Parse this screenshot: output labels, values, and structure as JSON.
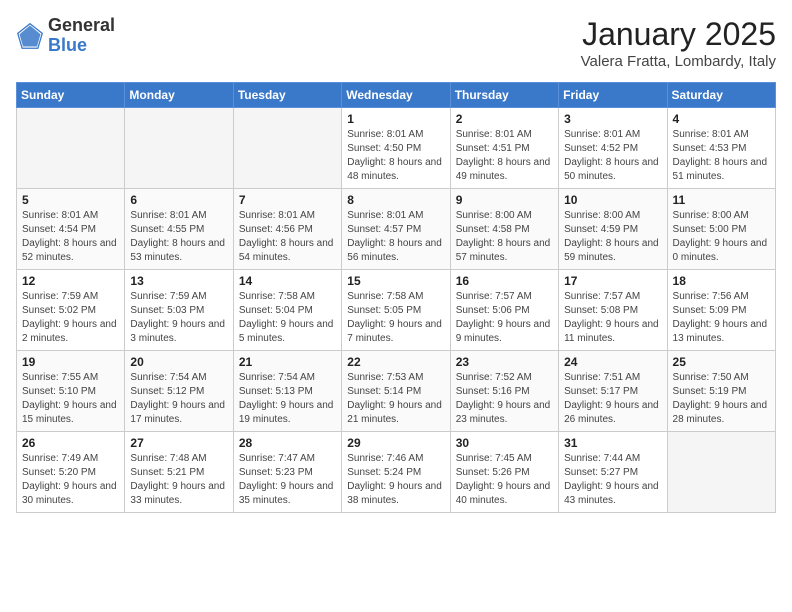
{
  "header": {
    "logo_general": "General",
    "logo_blue": "Blue",
    "month_title": "January 2025",
    "location": "Valera Fratta, Lombardy, Italy"
  },
  "weekdays": [
    "Sunday",
    "Monday",
    "Tuesday",
    "Wednesday",
    "Thursday",
    "Friday",
    "Saturday"
  ],
  "weeks": [
    [
      {
        "day": "",
        "sunrise": "",
        "sunset": "",
        "daylight": "",
        "empty": true
      },
      {
        "day": "",
        "sunrise": "",
        "sunset": "",
        "daylight": "",
        "empty": true
      },
      {
        "day": "",
        "sunrise": "",
        "sunset": "",
        "daylight": "",
        "empty": true
      },
      {
        "day": "1",
        "sunrise": "Sunrise: 8:01 AM",
        "sunset": "Sunset: 4:50 PM",
        "daylight": "Daylight: 8 hours and 48 minutes.",
        "empty": false
      },
      {
        "day": "2",
        "sunrise": "Sunrise: 8:01 AM",
        "sunset": "Sunset: 4:51 PM",
        "daylight": "Daylight: 8 hours and 49 minutes.",
        "empty": false
      },
      {
        "day": "3",
        "sunrise": "Sunrise: 8:01 AM",
        "sunset": "Sunset: 4:52 PM",
        "daylight": "Daylight: 8 hours and 50 minutes.",
        "empty": false
      },
      {
        "day": "4",
        "sunrise": "Sunrise: 8:01 AM",
        "sunset": "Sunset: 4:53 PM",
        "daylight": "Daylight: 8 hours and 51 minutes.",
        "empty": false
      }
    ],
    [
      {
        "day": "5",
        "sunrise": "Sunrise: 8:01 AM",
        "sunset": "Sunset: 4:54 PM",
        "daylight": "Daylight: 8 hours and 52 minutes.",
        "empty": false
      },
      {
        "day": "6",
        "sunrise": "Sunrise: 8:01 AM",
        "sunset": "Sunset: 4:55 PM",
        "daylight": "Daylight: 8 hours and 53 minutes.",
        "empty": false
      },
      {
        "day": "7",
        "sunrise": "Sunrise: 8:01 AM",
        "sunset": "Sunset: 4:56 PM",
        "daylight": "Daylight: 8 hours and 54 minutes.",
        "empty": false
      },
      {
        "day": "8",
        "sunrise": "Sunrise: 8:01 AM",
        "sunset": "Sunset: 4:57 PM",
        "daylight": "Daylight: 8 hours and 56 minutes.",
        "empty": false
      },
      {
        "day": "9",
        "sunrise": "Sunrise: 8:00 AM",
        "sunset": "Sunset: 4:58 PM",
        "daylight": "Daylight: 8 hours and 57 minutes.",
        "empty": false
      },
      {
        "day": "10",
        "sunrise": "Sunrise: 8:00 AM",
        "sunset": "Sunset: 4:59 PM",
        "daylight": "Daylight: 8 hours and 59 minutes.",
        "empty": false
      },
      {
        "day": "11",
        "sunrise": "Sunrise: 8:00 AM",
        "sunset": "Sunset: 5:00 PM",
        "daylight": "Daylight: 9 hours and 0 minutes.",
        "empty": false
      }
    ],
    [
      {
        "day": "12",
        "sunrise": "Sunrise: 7:59 AM",
        "sunset": "Sunset: 5:02 PM",
        "daylight": "Daylight: 9 hours and 2 minutes.",
        "empty": false
      },
      {
        "day": "13",
        "sunrise": "Sunrise: 7:59 AM",
        "sunset": "Sunset: 5:03 PM",
        "daylight": "Daylight: 9 hours and 3 minutes.",
        "empty": false
      },
      {
        "day": "14",
        "sunrise": "Sunrise: 7:58 AM",
        "sunset": "Sunset: 5:04 PM",
        "daylight": "Daylight: 9 hours and 5 minutes.",
        "empty": false
      },
      {
        "day": "15",
        "sunrise": "Sunrise: 7:58 AM",
        "sunset": "Sunset: 5:05 PM",
        "daylight": "Daylight: 9 hours and 7 minutes.",
        "empty": false
      },
      {
        "day": "16",
        "sunrise": "Sunrise: 7:57 AM",
        "sunset": "Sunset: 5:06 PM",
        "daylight": "Daylight: 9 hours and 9 minutes.",
        "empty": false
      },
      {
        "day": "17",
        "sunrise": "Sunrise: 7:57 AM",
        "sunset": "Sunset: 5:08 PM",
        "daylight": "Daylight: 9 hours and 11 minutes.",
        "empty": false
      },
      {
        "day": "18",
        "sunrise": "Sunrise: 7:56 AM",
        "sunset": "Sunset: 5:09 PM",
        "daylight": "Daylight: 9 hours and 13 minutes.",
        "empty": false
      }
    ],
    [
      {
        "day": "19",
        "sunrise": "Sunrise: 7:55 AM",
        "sunset": "Sunset: 5:10 PM",
        "daylight": "Daylight: 9 hours and 15 minutes.",
        "empty": false
      },
      {
        "day": "20",
        "sunrise": "Sunrise: 7:54 AM",
        "sunset": "Sunset: 5:12 PM",
        "daylight": "Daylight: 9 hours and 17 minutes.",
        "empty": false
      },
      {
        "day": "21",
        "sunrise": "Sunrise: 7:54 AM",
        "sunset": "Sunset: 5:13 PM",
        "daylight": "Daylight: 9 hours and 19 minutes.",
        "empty": false
      },
      {
        "day": "22",
        "sunrise": "Sunrise: 7:53 AM",
        "sunset": "Sunset: 5:14 PM",
        "daylight": "Daylight: 9 hours and 21 minutes.",
        "empty": false
      },
      {
        "day": "23",
        "sunrise": "Sunrise: 7:52 AM",
        "sunset": "Sunset: 5:16 PM",
        "daylight": "Daylight: 9 hours and 23 minutes.",
        "empty": false
      },
      {
        "day": "24",
        "sunrise": "Sunrise: 7:51 AM",
        "sunset": "Sunset: 5:17 PM",
        "daylight": "Daylight: 9 hours and 26 minutes.",
        "empty": false
      },
      {
        "day": "25",
        "sunrise": "Sunrise: 7:50 AM",
        "sunset": "Sunset: 5:19 PM",
        "daylight": "Daylight: 9 hours and 28 minutes.",
        "empty": false
      }
    ],
    [
      {
        "day": "26",
        "sunrise": "Sunrise: 7:49 AM",
        "sunset": "Sunset: 5:20 PM",
        "daylight": "Daylight: 9 hours and 30 minutes.",
        "empty": false
      },
      {
        "day": "27",
        "sunrise": "Sunrise: 7:48 AM",
        "sunset": "Sunset: 5:21 PM",
        "daylight": "Daylight: 9 hours and 33 minutes.",
        "empty": false
      },
      {
        "day": "28",
        "sunrise": "Sunrise: 7:47 AM",
        "sunset": "Sunset: 5:23 PM",
        "daylight": "Daylight: 9 hours and 35 minutes.",
        "empty": false
      },
      {
        "day": "29",
        "sunrise": "Sunrise: 7:46 AM",
        "sunset": "Sunset: 5:24 PM",
        "daylight": "Daylight: 9 hours and 38 minutes.",
        "empty": false
      },
      {
        "day": "30",
        "sunrise": "Sunrise: 7:45 AM",
        "sunset": "Sunset: 5:26 PM",
        "daylight": "Daylight: 9 hours and 40 minutes.",
        "empty": false
      },
      {
        "day": "31",
        "sunrise": "Sunrise: 7:44 AM",
        "sunset": "Sunset: 5:27 PM",
        "daylight": "Daylight: 9 hours and 43 minutes.",
        "empty": false
      },
      {
        "day": "",
        "sunrise": "",
        "sunset": "",
        "daylight": "",
        "empty": true
      }
    ]
  ]
}
